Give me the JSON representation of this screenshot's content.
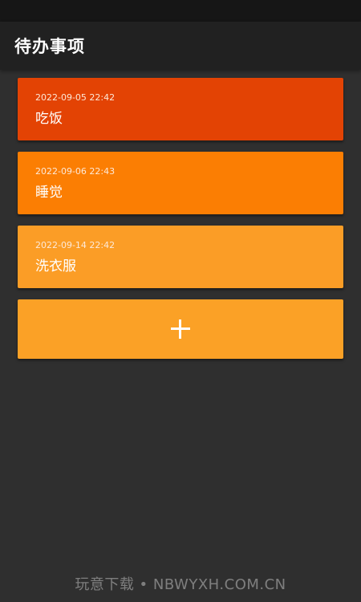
{
  "app": {
    "title": "待办事项"
  },
  "todos": [
    {
      "date": "2022-09-05 22:42",
      "title": "吃饭",
      "color": "#e34304"
    },
    {
      "date": "2022-09-06 22:43",
      "title": "睡觉",
      "color": "#fb7e03"
    },
    {
      "date": "2022-09-14 22:42",
      "title": "洗衣服",
      "color": "#fb9d26"
    }
  ],
  "add_button": {
    "icon": "plus-icon",
    "color": "#fba126"
  },
  "watermark": "玩意下载 • NBWYXH.COM.CN"
}
